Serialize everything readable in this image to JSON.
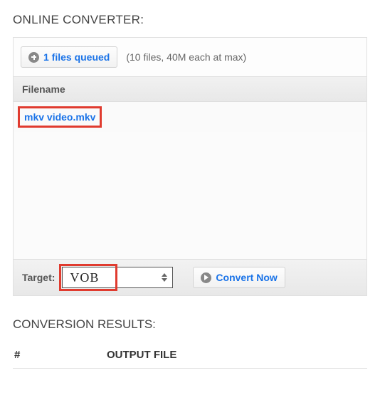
{
  "sections": {
    "converter_title": "ONLINE CONVERTER:",
    "results_title": "CONVERSION RESULTS:"
  },
  "queue": {
    "button_label": "1 files queued",
    "max_hint": "(10 files, 40M each at max)"
  },
  "table": {
    "header_filename": "Filename",
    "rows": [
      {
        "filename": "mkv video.mkv"
      }
    ]
  },
  "target": {
    "label": "Target:",
    "selected": "VOB"
  },
  "convert": {
    "button_label": "Convert Now"
  },
  "results_table": {
    "col_index": "#",
    "col_output": "OUTPUT FILE"
  }
}
